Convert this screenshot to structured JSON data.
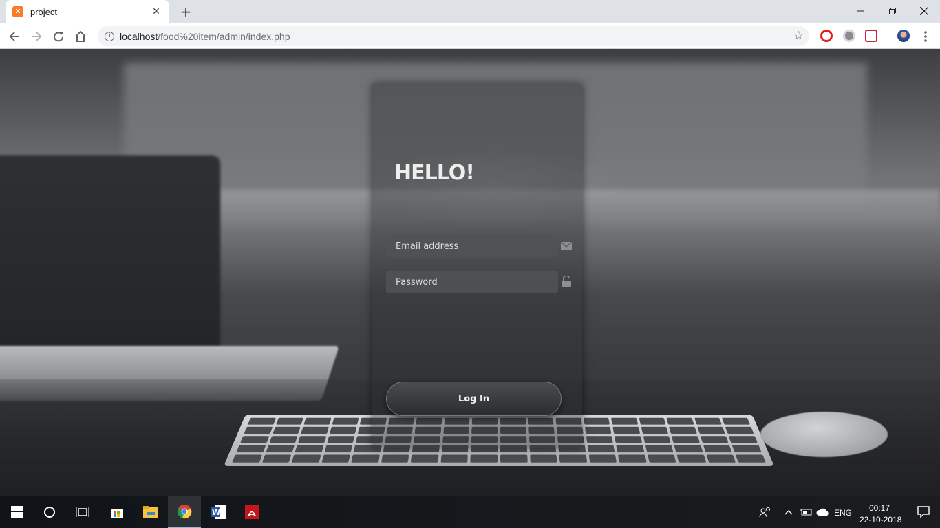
{
  "browser": {
    "tab_title": "project",
    "url_host": "localhost",
    "url_path": "/food%20item/admin/index.php",
    "icons": [
      "info-icon",
      "star-icon",
      "opera-icon",
      "extension-icon",
      "pocket-icon",
      "profile-avatar-icon"
    ]
  },
  "login": {
    "heading": "HELLO!",
    "email_placeholder": "Email address",
    "password_placeholder": "Password",
    "login_button": "Log In"
  },
  "taskbar": {
    "apps": [
      "windows-start-icon",
      "cortana-search-icon",
      "task-view-icon",
      "store-icon",
      "file-explorer-icon",
      "chrome-icon",
      "word-icon",
      "acrobat-icon"
    ],
    "language": "ENG",
    "time": "00:17",
    "date": "22-10-2018"
  },
  "colors": {
    "accent_tab": "#fb7a24",
    "taskbar_bg": "#14171a"
  }
}
